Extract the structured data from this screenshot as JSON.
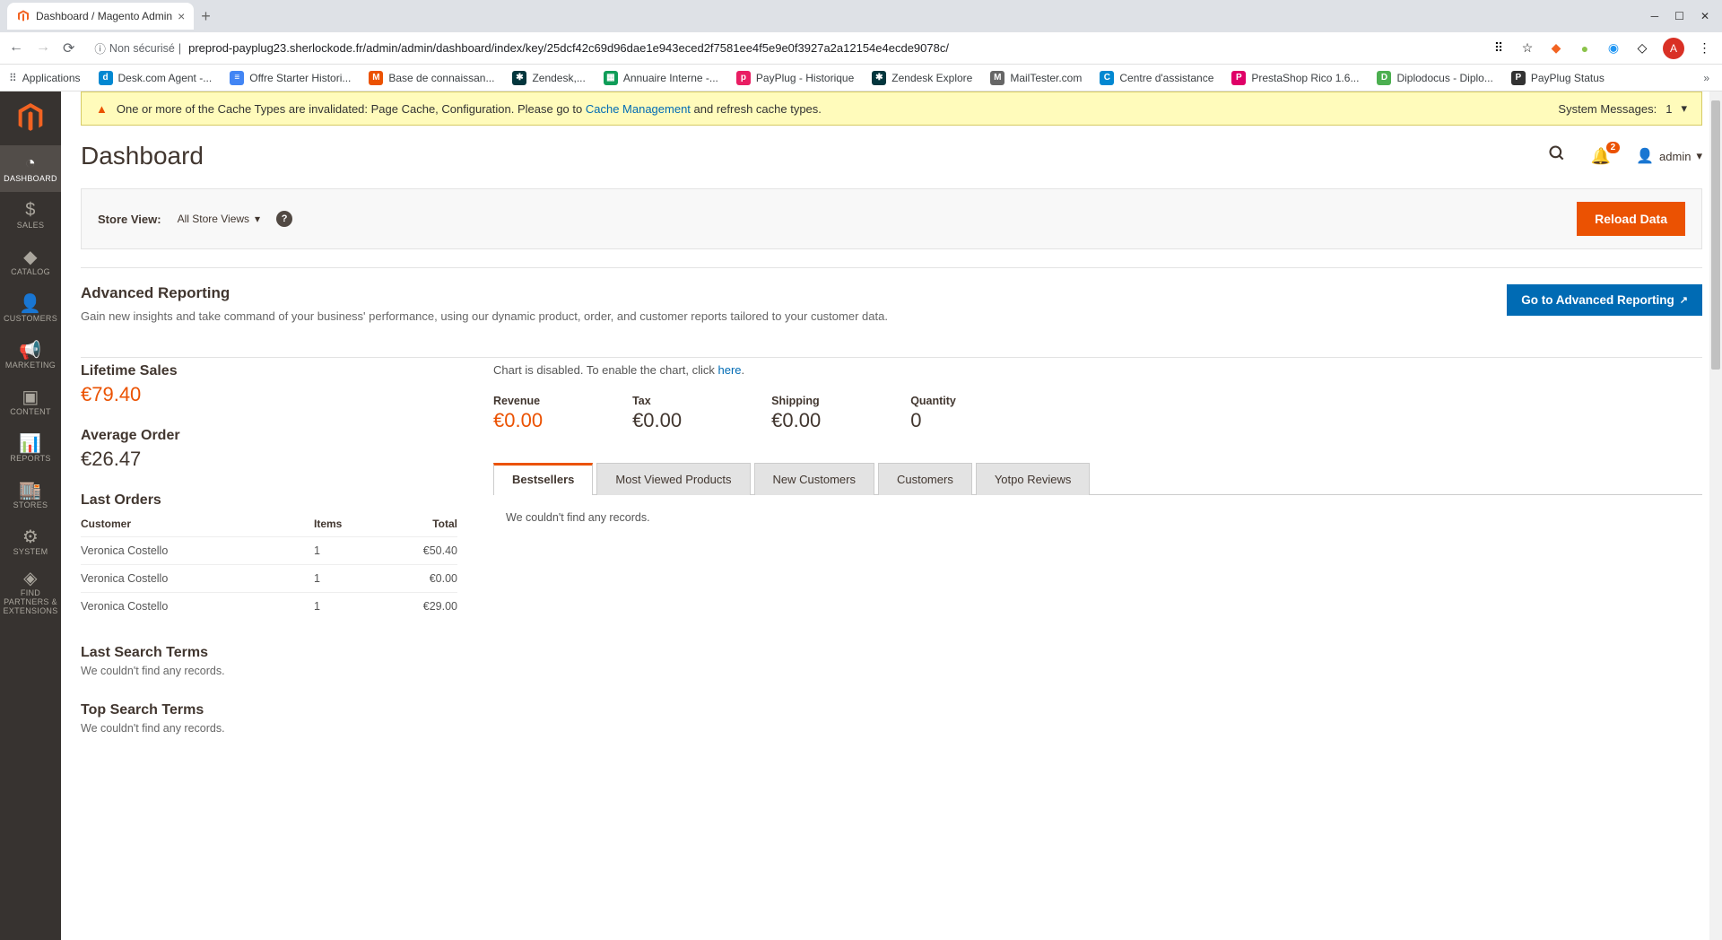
{
  "browser": {
    "tab_title": "Dashboard / Magento Admin",
    "site_info_prefix": "Non sécurisé",
    "url": "preprod-payplug23.sherlockode.fr/admin/admin/dashboard/index/key/25dcf42c69d96dae1e943eced2f7581ee4f5e9e0f3927a2a12154e4ecde9078c/",
    "avatar_letter": "A",
    "bookmarks": [
      {
        "label": "Applications",
        "color": "#5f6368",
        "icon_type": "grid"
      },
      {
        "label": "Desk.com Agent -...",
        "color": "#0288d1",
        "letter": "d"
      },
      {
        "label": "Offre Starter Histori...",
        "color": "#4285f4",
        "doc": true
      },
      {
        "label": "Base de connaissan...",
        "color": "#eb5202",
        "letter": "M"
      },
      {
        "label": "Zendesk,...",
        "color": "#03363d",
        "zen": true
      },
      {
        "label": "Annuaire Interne -...",
        "color": "#0f9d58",
        "sheet": true
      },
      {
        "label": "PayPlug - Historique",
        "color": "#e91e63",
        "letter": "p"
      },
      {
        "label": "Zendesk Explore",
        "color": "#03363d",
        "zen": true
      },
      {
        "label": "MailTester.com",
        "color": "#666",
        "letter": "M"
      },
      {
        "label": "Centre d'assistance",
        "color": "#0288d1",
        "letter": "C"
      },
      {
        "label": "PrestaShop Rico 1.6...",
        "color": "#df0067",
        "letter": "P"
      },
      {
        "label": "Diplodocus - Diplo...",
        "color": "#4caf50",
        "letter": "D"
      },
      {
        "label": "PayPlug Status",
        "color": "#333",
        "letter": "P"
      }
    ]
  },
  "sidebar": {
    "items": [
      {
        "label": "DASHBOARD",
        "icon": "◔",
        "active": true
      },
      {
        "label": "SALES",
        "icon": "$"
      },
      {
        "label": "CATALOG",
        "icon": "◆"
      },
      {
        "label": "CUSTOMERS",
        "icon": "👤"
      },
      {
        "label": "MARKETING",
        "icon": "📢"
      },
      {
        "label": "CONTENT",
        "icon": "▣"
      },
      {
        "label": "REPORTS",
        "icon": "📊"
      },
      {
        "label": "STORES",
        "icon": "🏬"
      },
      {
        "label": "SYSTEM",
        "icon": "⚙"
      },
      {
        "label": "FIND PARTNERS & EXTENSIONS",
        "icon": "◈"
      }
    ]
  },
  "system_message": {
    "text_before": "One or more of the Cache Types are invalidated: Page Cache, Configuration. Please go to ",
    "link": "Cache Management",
    "text_after": " and refresh cache types.",
    "right_label": "System Messages:",
    "right_count": "1"
  },
  "page": {
    "title": "Dashboard",
    "notification_count": "2",
    "user": "admin"
  },
  "store_bar": {
    "label": "Store View:",
    "selected": "All Store Views",
    "reload_label": "Reload Data"
  },
  "advanced_reporting": {
    "title": "Advanced Reporting",
    "desc": "Gain new insights and take command of your business' performance, using our dynamic product, order, and customer reports tailored to your customer data.",
    "button": "Go to Advanced Reporting"
  },
  "stats": {
    "lifetime_sales": {
      "label": "Lifetime Sales",
      "value": "€79.40"
    },
    "average_order": {
      "label": "Average Order",
      "value": "€26.47"
    }
  },
  "last_orders": {
    "title": "Last Orders",
    "headers": {
      "customer": "Customer",
      "items": "Items",
      "total": "Total"
    },
    "rows": [
      {
        "customer": "Veronica Costello",
        "items": "1",
        "total": "€50.40"
      },
      {
        "customer": "Veronica Costello",
        "items": "1",
        "total": "€0.00"
      },
      {
        "customer": "Veronica Costello",
        "items": "1",
        "total": "€29.00"
      }
    ]
  },
  "last_search": {
    "title": "Last Search Terms",
    "empty": "We couldn't find any records."
  },
  "top_search": {
    "title": "Top Search Terms",
    "empty": "We couldn't find any records."
  },
  "chart_note": {
    "before": "Chart is disabled. To enable the chart, click ",
    "link": "here",
    "after": "."
  },
  "kpis": [
    {
      "label": "Revenue",
      "value": "€0.00",
      "orange": true
    },
    {
      "label": "Tax",
      "value": "€0.00"
    },
    {
      "label": "Shipping",
      "value": "€0.00"
    },
    {
      "label": "Quantity",
      "value": "0"
    }
  ],
  "tabs": [
    {
      "label": "Bestsellers",
      "active": true
    },
    {
      "label": "Most Viewed Products"
    },
    {
      "label": "New Customers"
    },
    {
      "label": "Customers"
    },
    {
      "label": "Yotpo Reviews"
    }
  ],
  "tab_empty": "We couldn't find any records."
}
